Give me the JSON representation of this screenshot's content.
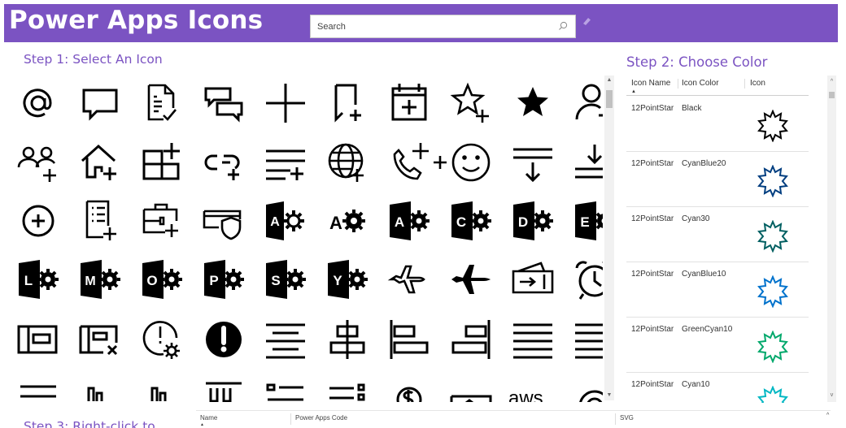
{
  "header": {
    "title": "Power Apps Icons",
    "search_placeholder": "Search",
    "search_value": ""
  },
  "sections": {
    "step1": "Step 1: Select An Icon",
    "step2": "Step 2: Choose Color",
    "step3": "Step 3: Right-click to"
  },
  "colors": {
    "header_bg": "#7b53c2",
    "accent": "#7b53c2"
  },
  "gallery": {
    "icons": [
      "at-icon",
      "comment-icon",
      "document-check-icon",
      "conversation-icon",
      "add-icon",
      "bookmark-add-icon",
      "calendar-add-icon",
      "star-add-icon",
      "star-filled-icon",
      "person-add-icon",
      "people-add-icon",
      "home-add-icon",
      "grid-add-icon",
      "link-add-icon",
      "list-add-icon",
      "globe-add-icon",
      "phone-add-icon",
      "emoji-add-icon",
      "sort-down-icon",
      "download-icon",
      "circle-add-icon",
      "document-list-add-icon",
      "briefcase-add-icon",
      "shield-card-icon",
      "access-app-icon",
      "admin-app-icon",
      "azure-app-icon",
      "crm-app-icon",
      "dynamics-app-icon",
      "exchange-app-icon",
      "lync-app-icon",
      "mail-app-icon",
      "outlook-app-icon",
      "project-app-icon",
      "sharepoint-app-icon",
      "yammer-app-icon",
      "airplane-outline-icon",
      "airplane-filled-icon",
      "airplane-ticket-icon",
      "alarm-clock-icon",
      "card-icon",
      "card-remove-icon",
      "alert-settings-icon",
      "alert-solid-icon",
      "align-center-icon",
      "align-h-center-icon",
      "align-left-icon",
      "align-right-icon",
      "align-justify-icon",
      "align-left-text-icon",
      "align-top-icon",
      "align-bottom-icon",
      "align-middle-icon",
      "align-top-columns-icon",
      "list-bullets-icon",
      "list-options-icon",
      "money-icon",
      "image-frame-icon",
      "aws-text-icon",
      "circle-record-icon"
    ],
    "aws_label": "aws"
  },
  "color_table": {
    "headers": [
      "Icon Name",
      "Icon Color",
      "Icon"
    ],
    "rows": [
      {
        "name": "12PointStar",
        "color_name": "Black",
        "color": "#000000"
      },
      {
        "name": "12PointStar",
        "color_name": "CyanBlue20",
        "color": "#003e80"
      },
      {
        "name": "12PointStar",
        "color_name": "Cyan30",
        "color": "#005f61"
      },
      {
        "name": "12PointStar",
        "color_name": "CyanBlue10",
        "color": "#0072cc"
      },
      {
        "name": "12PointStar",
        "color_name": "GreenCyan10",
        "color": "#00a86b"
      },
      {
        "name": "12PointStar",
        "color_name": "Cyan10",
        "color": "#00b7c3"
      }
    ]
  },
  "code_table": {
    "headers": [
      "Name",
      "Power Apps Code",
      "SVG"
    ]
  }
}
